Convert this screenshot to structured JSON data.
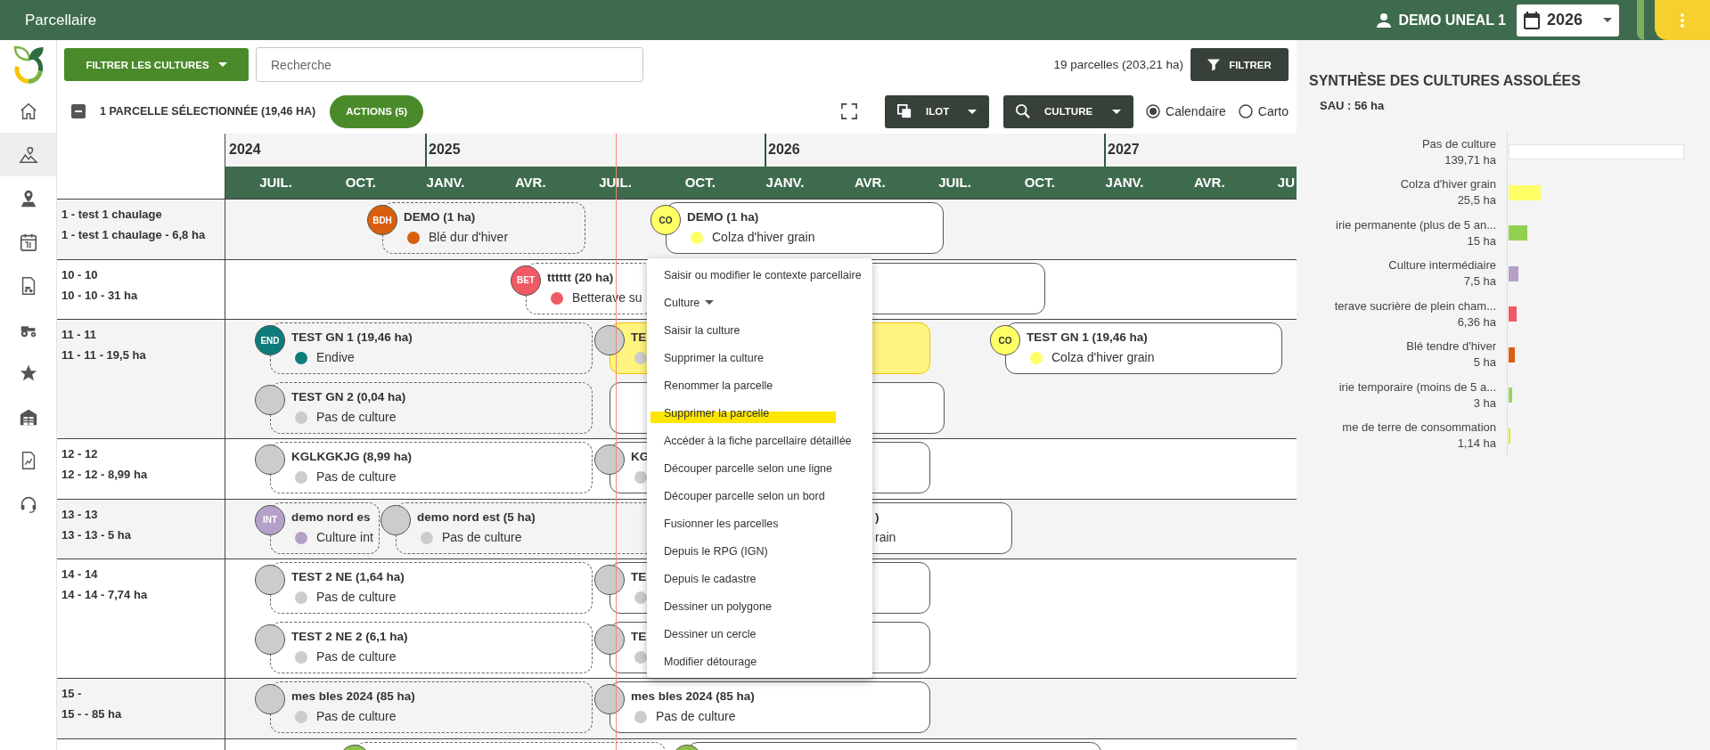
{
  "app_bar": {
    "title": "Parcellaire",
    "user": "DEMO UNEAL 1",
    "year": "2026"
  },
  "sidebar": {
    "items": [
      {
        "kind": "home",
        "selected": false
      },
      {
        "kind": "field",
        "selected": true
      },
      {
        "kind": "location",
        "selected": false
      },
      {
        "kind": "calendar",
        "selected": false
      },
      {
        "kind": "document",
        "selected": false
      },
      {
        "kind": "tractor",
        "selected": false
      },
      {
        "kind": "star",
        "selected": false
      },
      {
        "kind": "farm",
        "selected": false
      },
      {
        "kind": "report",
        "selected": false
      },
      {
        "kind": "support",
        "selected": false
      }
    ]
  },
  "toolbar": {
    "crop_filter_button": "FILTRER LES CULTURES",
    "search": {
      "placeholder": "Recherche"
    },
    "parcel_count": "19 parcelles (203,21 ha)",
    "filter_button": "FILTRER"
  },
  "selection_bar": {
    "partial_selection": true,
    "label": "1 PARCELLE SÉLECTIONNÉE (19,46 HA)",
    "actions_button": "ACTIONS (5)",
    "group_by": [
      {
        "kind": "ilot",
        "label": "ILOT"
      },
      {
        "kind": "crop",
        "label": "CULTURE"
      }
    ],
    "views": [
      {
        "label": "Calendaire",
        "selected": true
      },
      {
        "label": "Carto",
        "selected": false
      }
    ]
  },
  "timeline": {
    "years": [
      "2024",
      "2025",
      "2026",
      "2027"
    ],
    "months": [
      "JUIL.",
      "OCT.",
      "JANV.",
      "AVR.",
      "JUIL.",
      "OCT.",
      "JANV.",
      "AVR.",
      "JUIL.",
      "OCT.",
      "JANV.",
      "AVR.",
      "JU"
    ],
    "today_marker": true,
    "rows": [
      {
        "name": "1 - test 1 chaulage",
        "detail": "1 - test 1 chaulage - 6,8 ha",
        "lanes": [
          [
            {
              "kind": "previous",
              "selected": false,
              "badge": "BDH",
              "color": "#d95f0e",
              "title": "DEMO (1 ha)",
              "crop": "Blé dur d'hiver"
            },
            {
              "kind": "current",
              "selected": false,
              "badge": "CO",
              "color": "#ffff66",
              "title": "DEMO (1 ha)",
              "crop": "Colza d'hiver grain"
            }
          ]
        ]
      },
      {
        "name": "10 - 10",
        "detail": "10 - 10 - 31 ha",
        "lanes": [
          [
            {
              "kind": "previous",
              "selected": false,
              "badge": "BET",
              "color": "#f05a65",
              "title": "tttttt (20 ha)",
              "crop": "Betterave su"
            },
            {
              "kind": "current",
              "selected": false
            }
          ]
        ]
      },
      {
        "name": "11 - 11",
        "detail": "11 - 11 - 19,5 ha",
        "lanes": [
          [
            {
              "kind": "previous",
              "selected": false,
              "badge": "END",
              "color": "#0e7c7b",
              "title": "TEST GN 1 (19,46 ha)",
              "crop": "Endive"
            },
            {
              "kind": "current",
              "selected": true,
              "color": "#cccccc",
              "title": "TE"
            },
            {
              "kind": "current",
              "selected": false,
              "badge": "CO",
              "color": "#ffff66",
              "title": "TEST GN 1 (19,46 ha)",
              "crop": "Colza d'hiver grain"
            }
          ],
          [
            {
              "kind": "previous",
              "selected": false,
              "color": "#cccccc",
              "title": "TEST GN 2 (0,04 ha)",
              "crop": "Pas de culture"
            },
            {
              "kind": "current",
              "selected": false
            }
          ]
        ]
      },
      {
        "name": "12 - 12",
        "detail": "12 - 12 - 8,99 ha",
        "lanes": [
          [
            {
              "kind": "previous",
              "selected": false,
              "color": "#cccccc",
              "title": "KGLKGKJG (8,99 ha)",
              "crop": "Pas de culture"
            },
            {
              "kind": "current",
              "selected": false,
              "color": "#cccccc",
              "title": "KG"
            }
          ]
        ]
      },
      {
        "name": "13 - 13",
        "detail": "13 - 13 - 5 ha",
        "lanes": [
          [
            {
              "kind": "previous",
              "selected": false,
              "badge": "INT",
              "color": "#b4a0c8",
              "title": "demo nord es",
              "crop": "Culture int"
            },
            {
              "kind": "previous",
              "selected": false,
              "color": "#cccccc",
              "title": "demo nord est (5 ha)",
              "crop": "Pas de culture"
            },
            {
              "kind": "current",
              "selected": false,
              "title": ")",
              "crop": "rain"
            }
          ]
        ]
      },
      {
        "name": "14 - 14",
        "detail": "14 - 14 - 7,74 ha",
        "lanes": [
          [
            {
              "kind": "previous",
              "selected": false,
              "color": "#cccccc",
              "title": "TEST 2 NE (1,64 ha)",
              "crop": "Pas de culture"
            },
            {
              "kind": "current",
              "selected": false,
              "color": "#cccccc",
              "title": "TE"
            }
          ],
          [
            {
              "kind": "previous",
              "selected": false,
              "color": "#cccccc",
              "title": "TEST 2 NE 2 (6,1 ha)",
              "crop": "Pas de culture"
            },
            {
              "kind": "current",
              "selected": false,
              "color": "#cccccc",
              "title": "TE"
            }
          ]
        ]
      },
      {
        "name": "15 -",
        "detail": "15 - - 85 ha",
        "lanes": [
          [
            {
              "kind": "previous",
              "selected": false,
              "color": "#cccccc",
              "title": "mes bles 2024 (85 ha)",
              "crop": "Pas de culture"
            },
            {
              "kind": "current",
              "selected": false,
              "color": "#cccccc",
              "title": "mes bles 2024 (85 ha)",
              "crop": "Pas de culture"
            }
          ]
        ]
      },
      {
        "lanes": [
          [
            {
              "kind": "previous",
              "selected": false,
              "color": "#8bc34a"
            },
            {
              "kind": "current",
              "selected": false,
              "color": "#8bc34a"
            }
          ]
        ]
      }
    ]
  },
  "context_menu": {
    "items": [
      {
        "kind": "action",
        "highlighted": false,
        "label": "Saisir ou modifier le contexte parcellaire"
      },
      {
        "kind": "submenu",
        "highlighted": false,
        "label": "Culture"
      },
      {
        "kind": "action",
        "highlighted": false,
        "label": "Saisir la culture"
      },
      {
        "kind": "action",
        "highlighted": false,
        "label": "Supprimer la culture"
      },
      {
        "kind": "action",
        "highlighted": false,
        "label": "Renommer la parcelle"
      },
      {
        "kind": "action",
        "highlighted": true,
        "label": "Supprimer la parcelle"
      },
      {
        "kind": "action",
        "highlighted": false,
        "label": "Accéder à la fiche parcellaire détaillée"
      },
      {
        "kind": "action",
        "highlighted": false,
        "label": "Découper parcelle selon une ligne"
      },
      {
        "kind": "action",
        "highlighted": false,
        "label": "Découper parcelle selon un bord"
      },
      {
        "kind": "action",
        "highlighted": false,
        "label": "Fusionner les parcelles"
      },
      {
        "kind": "action",
        "highlighted": false,
        "label": "Depuis le RPG (IGN)"
      },
      {
        "kind": "action",
        "highlighted": false,
        "label": "Depuis le cadastre"
      },
      {
        "kind": "action",
        "highlighted": false,
        "label": "Dessiner un polygone"
      },
      {
        "kind": "action",
        "highlighted": false,
        "label": "Dessiner un cercle"
      },
      {
        "kind": "action",
        "highlighted": false,
        "label": "Modifier détourage"
      }
    ]
  },
  "summary": {
    "title": "SYNTHÈSE DES CULTURES ASSOLÉES",
    "sau": "SAU : 56 ha",
    "crop_areas": [
      {
        "name": "Pas de culture",
        "area": "139,71 ha",
        "color": "#ffffff",
        "level": 1
      },
      {
        "name": "Colza d'hiver grain",
        "area": "25,5 ha",
        "color": "#ffff66",
        "level": 0.1825
      },
      {
        "name": "irie permanente (plus de 5 an...",
        "area": "15 ha",
        "color": "#92d050",
        "level": 0.1074
      },
      {
        "name": "Culture intermédiaire",
        "area": "7,5 ha",
        "color": "#b4a0c8",
        "level": 0.0537
      },
      {
        "name": "terave sucrière de plein cham...",
        "area": "6,36 ha",
        "color": "#f05a65",
        "level": 0.0455
      },
      {
        "name": "Blé tendre d'hiver",
        "area": "5 ha",
        "color": "#d95f0e",
        "level": 0.0358
      },
      {
        "name": "irie temporaire (moins de 5 a...",
        "area": "3 ha",
        "color": "#9ad45a",
        "level": 0.0215
      },
      {
        "name": "me de terre de consommation",
        "area": "1,14 ha",
        "color": "#e5e500",
        "level": 0.0082
      }
    ]
  }
}
